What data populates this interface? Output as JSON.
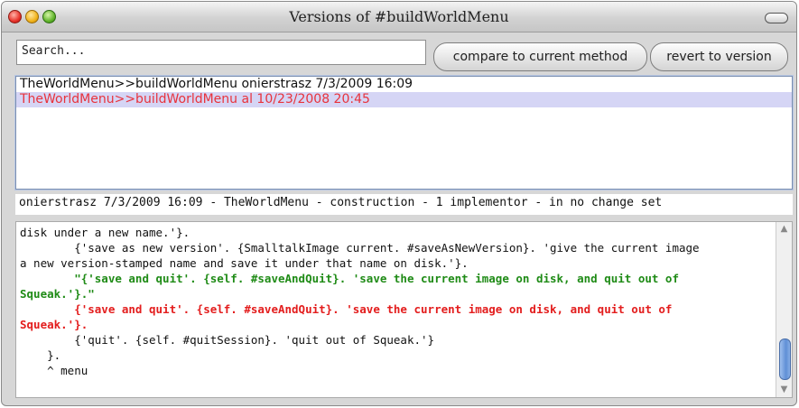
{
  "window": {
    "title": "Versions of #buildWorldMenu"
  },
  "search": {
    "placeholder": "Search..."
  },
  "toolbar": {
    "compare_label": "compare to current method",
    "revert_label": "revert to version"
  },
  "versions": [
    {
      "label": "TheWorldMenu>>buildWorldMenu onierstrasz 7/3/2009 16:09",
      "selected": false
    },
    {
      "label": "TheWorldMenu>>buildWorldMenu al 10/23/2008 20:45",
      "selected": true
    }
  ],
  "status": {
    "text": "onierstrasz 7/3/2009 16:09 - TheWorldMenu - construction - 1 implementor - in no change set"
  },
  "code": {
    "lines": [
      {
        "text": "disk under a new name.'}.",
        "kind": "normal"
      },
      {
        "text": "        {'save as new version'. {SmalltalkImage current. #saveAsNewVersion}. 'give the current image",
        "kind": "normal"
      },
      {
        "text": "a new version-stamped name and save it under that name on disk.'}.",
        "kind": "normal"
      },
      {
        "text": "        \"{'save and quit'. {self. #saveAndQuit}. 'save the current image on disk, and quit out of",
        "kind": "added"
      },
      {
        "text": "Squeak.'}.\"",
        "kind": "added"
      },
      {
        "text": "        {'save and quit'. {self. #saveAndQuit}. 'save the current image on disk, and quit out of",
        "kind": "removed"
      },
      {
        "text": "Squeak.'}.",
        "kind": "removed"
      },
      {
        "text": "        {'quit'. {self. #quitSession}. 'quit out of Squeak.'}",
        "kind": "normal"
      },
      {
        "text": "    }.",
        "kind": "normal"
      },
      {
        "text": "    ^ menu",
        "kind": "normal"
      }
    ]
  },
  "colors": {
    "selected_row_bg": "#d5d5f5",
    "selected_row_text": "#e8333c",
    "diff_added": "#1f8b16",
    "diff_removed": "#e31d1d",
    "scroll_thumb": "#5f8fd6"
  },
  "icons": {
    "close": "close-icon",
    "minimize": "minimize-icon",
    "zoom": "zoom-icon",
    "collapse": "collapse-icon",
    "scroll_up": "scroll-up-arrow-icon",
    "scroll_down": "scroll-down-arrow-icon"
  }
}
